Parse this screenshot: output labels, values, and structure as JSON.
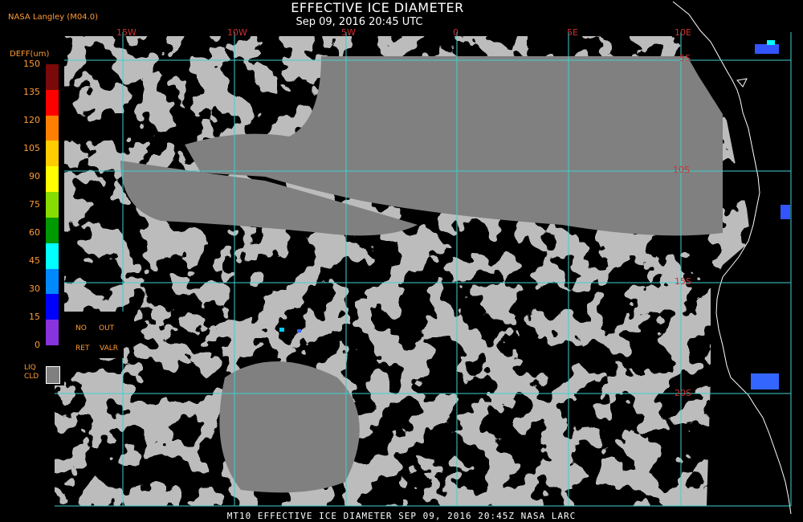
{
  "header": {
    "title": "EFFECTIVE ICE DIAMETER",
    "subtitle": "Sep 09, 2016 20:45 UTC",
    "credit": "NASA Langley (M04.0)"
  },
  "legend": {
    "unit_label": "DEFF(um)",
    "ticks": [
      "150",
      "135",
      "120",
      "105",
      "90",
      "75",
      "60",
      "45",
      "30",
      "15",
      "0"
    ],
    "colors": [
      "#7a0a0a",
      "#ff0000",
      "#ff8000",
      "#ffcc00",
      "#ffff00",
      "#88dd00",
      "#009900",
      "#00ffff",
      "#0088ff",
      "#0000ff",
      "#8833dd"
    ],
    "no_label": "NO",
    "out_label": "OUT",
    "ret_label": "RET",
    "valr_label": "VALR",
    "liq_label": "LIQ",
    "cld_label": "CLD",
    "liq_color": "#808080"
  },
  "map": {
    "lon_labels": [
      "15W",
      "10W",
      "5W",
      "0",
      "5E",
      "10E"
    ],
    "lat_labels": [
      "5S",
      "10S",
      "15S",
      "20S"
    ],
    "grid_color": "#40d0d0",
    "cloud_color": "#808080",
    "coast_color": "#ffffff"
  },
  "footer": {
    "text": "MT10  EFFECTIVE ICE DIAMETER   SEP 09, 2016 20:45Z   NASA LARC"
  }
}
